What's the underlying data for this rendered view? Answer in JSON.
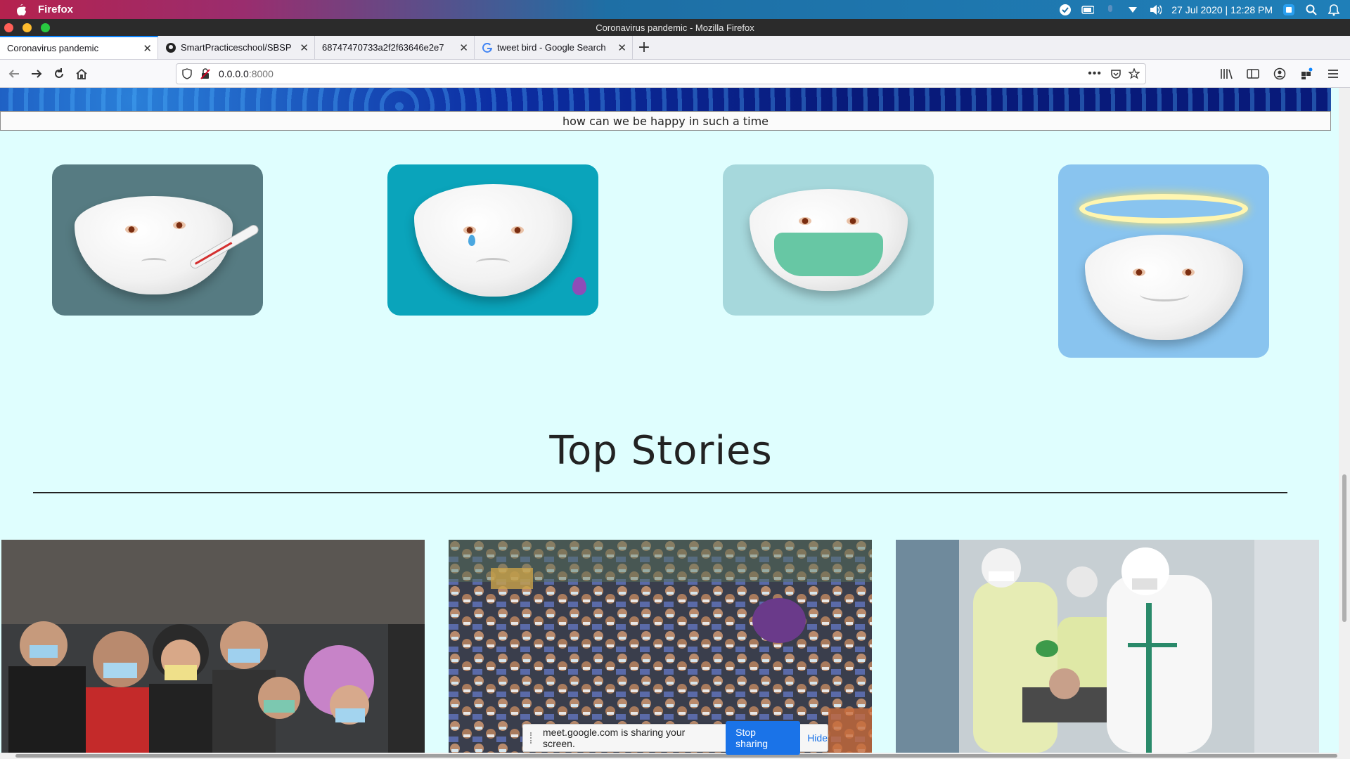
{
  "os_bar": {
    "app_name": "Firefox",
    "datetime": "27 Jul 2020 | 12:28 PM"
  },
  "window": {
    "title": "Coronavirus pandemic - Mozilla Firefox"
  },
  "tabs": [
    {
      "label": "Coronavirus pandemic",
      "active": true
    },
    {
      "label": "SmartPracticeschool/SBSP",
      "icon": "github-icon"
    },
    {
      "label": "68747470733a2f2f63646e2e7"
    },
    {
      "label": "tweet bird - Google Search",
      "icon": "google-icon"
    }
  ],
  "urlbar": {
    "host": "0.0.0.0",
    "port": ":8000"
  },
  "page": {
    "caption": "how can we be happy in such a time",
    "emotion_cards": [
      {
        "name": "sick-bowl",
        "bg": "#567b82"
      },
      {
        "name": "crying-bowl",
        "bg": "#0aa4bb"
      },
      {
        "name": "masked-bowl",
        "bg": "#a6d8dc"
      },
      {
        "name": "angel-bowl",
        "bg": "#89c4ef"
      }
    ],
    "section_title": "Top Stories",
    "stories": [
      {
        "name": "crowd-with-masks"
      },
      {
        "name": "dense-crowd"
      },
      {
        "name": "medical-workers"
      }
    ]
  },
  "share_bar": {
    "message": "meet.google.com is sharing your screen.",
    "stop_label": "Stop sharing",
    "hide_label": "Hide"
  },
  "colors": {
    "page_bg": "#dffefe",
    "accent": "#0a84ff",
    "share_button": "#1a73e8"
  }
}
